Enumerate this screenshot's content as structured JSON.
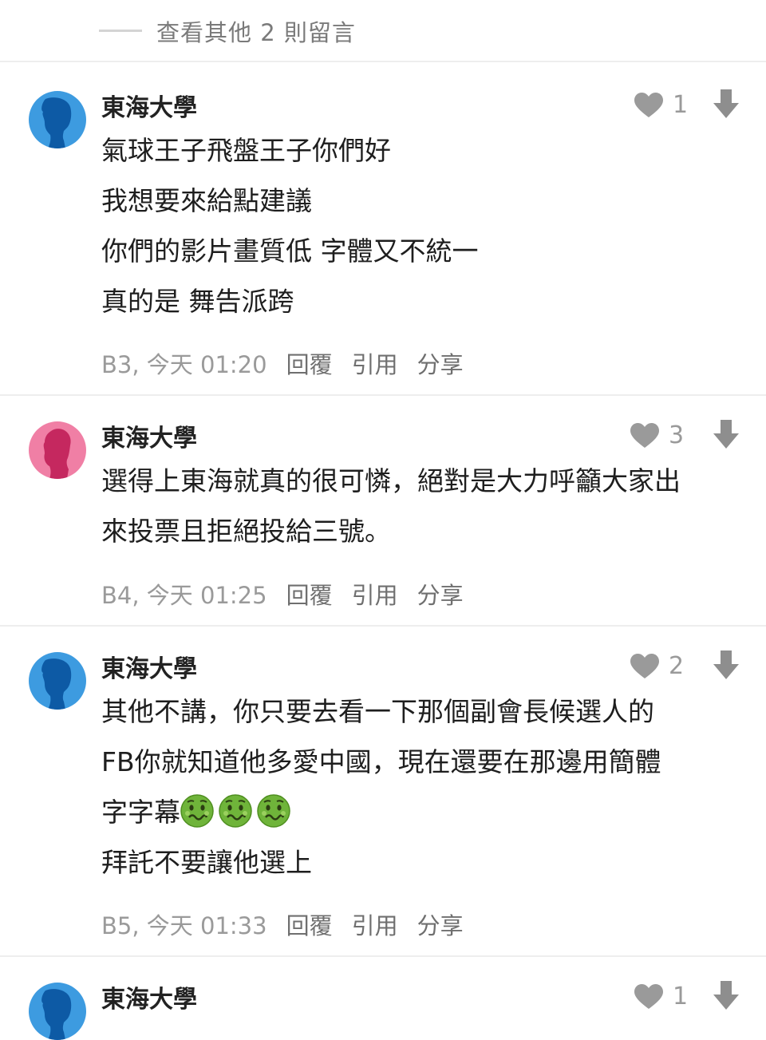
{
  "more_link": "查看其他 2 則留言",
  "comments": [
    {
      "author": "東海大學",
      "avatar": "male-silhouette-icon",
      "likes": "1",
      "lines": [
        "氣球王子飛盤王子你們好",
        "我想要來給點建議",
        "你們的影片畫質低 字體又不統一",
        "真的是 舞告派跨"
      ],
      "floor": "B3, 今天 01:20",
      "actions": [
        "回覆",
        "引用",
        "分享"
      ]
    },
    {
      "author": "東海大學",
      "avatar": "female-silhouette-icon",
      "likes": "3",
      "lines": [
        "選得上東海就真的很可憐，絕對是大力呼籲大家出",
        "來投票且拒絕投給三號。"
      ],
      "floor": "B4, 今天 01:25",
      "actions": [
        "回覆",
        "引用",
        "分享"
      ]
    },
    {
      "author": "東海大學",
      "avatar": "male-silhouette-icon",
      "likes": "2",
      "lines": [
        "其他不講，你只要去看一下那個副會長候選人的",
        "FB你就知道他多愛中國，現在還要在那邊用簡體",
        "字字幕",
        "拜託不要讓他選上"
      ],
      "line3_emojis": [
        "nauseated-face-emoji",
        "nauseated-face-emoji",
        "nauseated-face-emoji"
      ],
      "floor": "B5, 今天 01:33",
      "actions": [
        "回覆",
        "引用",
        "分享"
      ]
    },
    {
      "author": "東海大學",
      "avatar": "male-silhouette-icon",
      "likes": "1"
    }
  ],
  "colors": {
    "male_avatar": "#3d9be0",
    "female_avatar": "#f07fa5",
    "icon_gray": "#9a9a9a"
  }
}
